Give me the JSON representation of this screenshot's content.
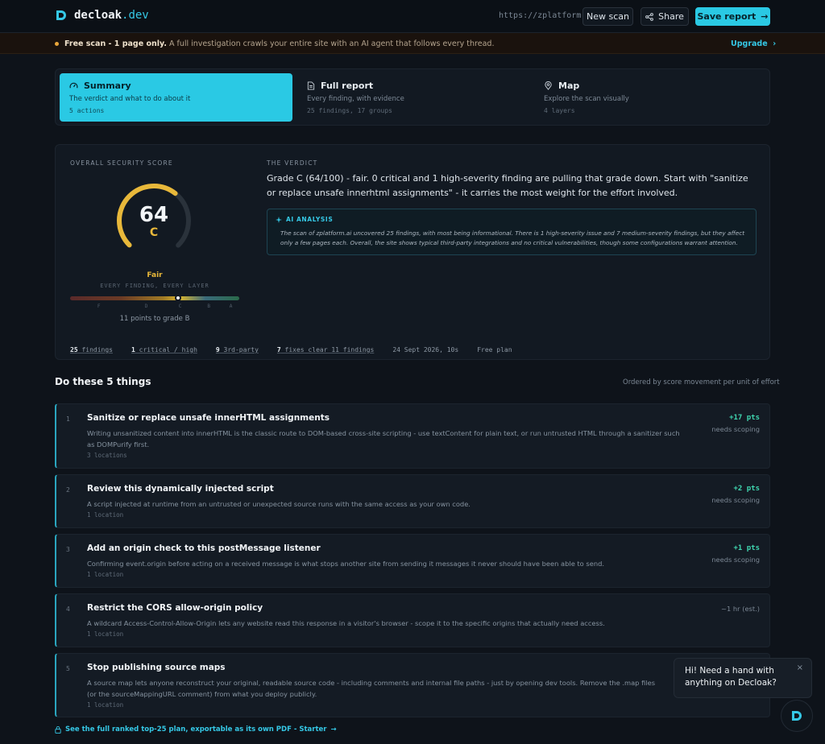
{
  "header": {
    "brand_name": "decloak",
    "brand_tld": ".dev",
    "scan_url": "https://zplatform.ai",
    "new_scan_label": "New scan",
    "share_label": "Share",
    "save_label": "Save report",
    "save_arrow": "→"
  },
  "banner": {
    "bold_text": "Free scan - 1 page only.",
    "text": " A full investigation crawls your entire site with an AI agent that follows every thread.",
    "upgrade_label": "Upgrade",
    "upgrade_arrow": "›"
  },
  "tabs": [
    {
      "label": "Summary",
      "sub": "The verdict and what to do about it",
      "count": "5 actions",
      "icon": "gauge-icon"
    },
    {
      "label": "Full report",
      "sub": "Every finding, with evidence",
      "count": "25 findings, 17 groups",
      "icon": "document-icon"
    },
    {
      "label": "Map",
      "sub": "Explore the scan visually",
      "count": "4 layers",
      "icon": "map-icon"
    }
  ],
  "score": {
    "label": "OVERALL SECURITY SCORE",
    "value": "64",
    "max": 100,
    "grade": "C",
    "rating": "Fair",
    "scale_caption": "EVERY FINDING, EVERY LAYER",
    "scale_ticks": [
      "F",
      "D",
      "C",
      "B",
      "A"
    ],
    "marker_fraction": 0.64,
    "to_next": "11 points to grade B",
    "accent_color": "#e8b83a"
  },
  "verdict": {
    "label": "THE VERDICT",
    "text": "Grade C (64/100) - fair. 0 critical and 1 high-severity finding are pulling that grade down. Start with \"sanitize or replace unsafe innerhtml assignments\" - it carries the most weight for the effort involved."
  },
  "ai": {
    "title": "AI ANALYSIS",
    "text": "The scan of zplatform.ai uncovered 25 findings, with most being informational. There is 1 high-severity issue and 7 medium-severity findings, but they affect only a few pages each. Overall, the site shows typical third-party integrations and no critical vulnerabilities, though some configurations warrant attention."
  },
  "stats": [
    {
      "num": "25",
      "label": " findings"
    },
    {
      "num": "1",
      "label": " critical / high"
    },
    {
      "num": "9",
      "label": " 3rd-party"
    },
    {
      "num": "7",
      "label": " fixes clear 11 findings"
    }
  ],
  "scan_date": "24 Sept 2026, 10s",
  "plan": "Free plan",
  "actions_title": "Do these 5 things",
  "actions_sub": "Ordered by score movement per unit of effort",
  "actions": [
    {
      "num": "1",
      "title": "Sanitize or replace unsafe innerHTML assignments",
      "desc": "Writing unsanitized content into innerHTML is the classic route to DOM-based cross-site scripting - use textContent for plain text, or run untrusted HTML through a sanitizer such as DOMPurify first.",
      "loc": "3 locations",
      "pts": "+17 pts",
      "scope": "needs scoping"
    },
    {
      "num": "2",
      "title": "Review this dynamically injected script",
      "desc": "A script injected at runtime from an untrusted or unexpected source runs with the same access as your own code.",
      "loc": "1 location",
      "pts": "+2 pts",
      "scope": "needs scoping"
    },
    {
      "num": "3",
      "title": "Add an origin check to this postMessage listener",
      "desc": "Confirming event.origin before acting on a received message is what stops another site from sending it messages it never should have been able to send.",
      "loc": "1 location",
      "pts": "+1 pts",
      "scope": "needs scoping"
    },
    {
      "num": "4",
      "title": "Restrict the CORS allow-origin policy",
      "desc": "A wildcard Access-Control-Allow-Origin lets any website read this response in a visitor's browser - scope it to the specific origins that actually need access.",
      "loc": "1 location",
      "est": "~1 hr (est.)"
    },
    {
      "num": "5",
      "title": "Stop publishing source maps",
      "desc": "A source map lets anyone reconstruct your original, readable source code - including comments and internal file paths - just by opening dev tools. Remove the .map files (or the sourceMappingURL comment) from what you deploy publicly.",
      "loc": "1 location"
    }
  ],
  "footer_link": "See the full ranked top-25 plan, exportable as its own PDF - Starter",
  "footer_arrow": "→",
  "chat": {
    "text": "Hi! Need a hand with anything on Decloak?",
    "close": "×"
  },
  "colors": {
    "accent": "#2ac9e4",
    "grade": "#e8b83a",
    "points": "#3fd6b0"
  }
}
